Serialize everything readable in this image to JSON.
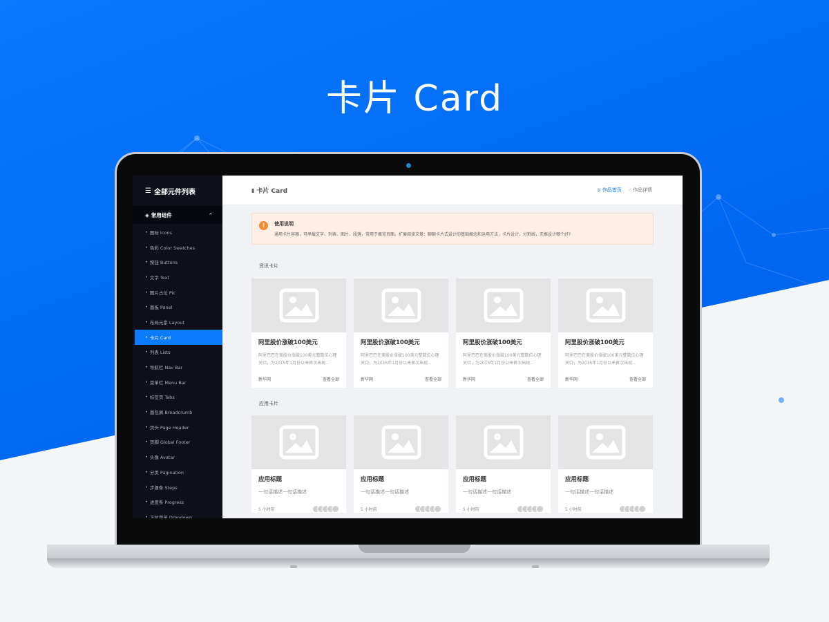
{
  "hero": {
    "title": "卡片 Card"
  },
  "sidebar": {
    "header": "全部元件列表",
    "group": "常用组件",
    "items": [
      "图标 Icons",
      "色彩 Color Swatches",
      "按钮 Buttons",
      "文字 Text",
      "图片占位 Pic",
      "面板 Panel",
      "布局元素 Layout",
      "卡片 Card",
      "列表 Lists",
      "导航栏 Nav Bar",
      "菜单栏 Menu Bar",
      "标签页 Tabs",
      "面包屑 Breadcrumb",
      "页头 Page Header",
      "页脚 Global Footer",
      "头像 Avatar",
      "分页 Pagination",
      "步骤条 Steps",
      "进度条 Progress",
      "下拉菜单 Dropdown"
    ],
    "active_index": 7
  },
  "topbar": {
    "title": "卡片 Card",
    "home_link": "作品首页",
    "detail_link": "作品详情"
  },
  "notice": {
    "title": "使用说明",
    "text": "通用卡片容器，可承载文字、列表、图片、段落，常用于概览页面。扩展阅读文章：聊聊卡片式设计的基础概念和运用方法，卡片设计，分割线，无框设计哪个好?"
  },
  "news_section": {
    "label": "资讯卡片",
    "cards": [
      {
        "title": "阿里股价涨破100美元",
        "desc": "阿里巴巴在美股价涨破100美元整数位心理关口，为2015年1月份以来首次出现...",
        "source": "新华网",
        "more": "查看全部"
      },
      {
        "title": "阿里股价涨破100美元",
        "desc": "阿里巴巴在美股价涨破100美元整数位心理关口，为2015年1月份以来首次出现...",
        "source": "新华网",
        "more": "查看全部"
      },
      {
        "title": "阿里股价涨破100美元",
        "desc": "阿里巴巴在美股价涨破100美元整数位心理关口，为2015年1月份以来首次出现...",
        "source": "新华网",
        "more": "查看全部"
      },
      {
        "title": "阿里股价涨破100美元",
        "desc": "阿里巴巴在美股价涨破100美元整数位心理关口，为2015年1月份以来首次出现...",
        "source": "新华网",
        "more": "查看全部"
      }
    ]
  },
  "app_section": {
    "label": "应用卡片",
    "cards": [
      {
        "title": "应用标题",
        "desc": "一句话描述一句话描述",
        "time": "5 小时前"
      },
      {
        "title": "应用标题",
        "desc": "一句话描述一句话描述",
        "time": "5 小时前"
      },
      {
        "title": "应用标题",
        "desc": "一句话描述一句话描述",
        "time": "5 小时前"
      },
      {
        "title": "应用标题",
        "desc": "一句话描述一句话描述",
        "time": "5 小时前"
      }
    ]
  },
  "colors": {
    "brand_blue": "#0b7bff",
    "sidebar_bg": "#0d1019",
    "notice_bg": "#fdeee6",
    "warn_orange": "#f28a30"
  },
  "icons": {
    "sidebar_header": "list-icon",
    "group": "cube-icon",
    "group_toggle": "chevron-up-icon",
    "topbar_title": "bookmark-icon",
    "home_link": "arrow-circle-icon",
    "detail_link": "thumbs-up-icon",
    "notice": "warning-icon",
    "card_image": "image-placeholder-icon"
  }
}
